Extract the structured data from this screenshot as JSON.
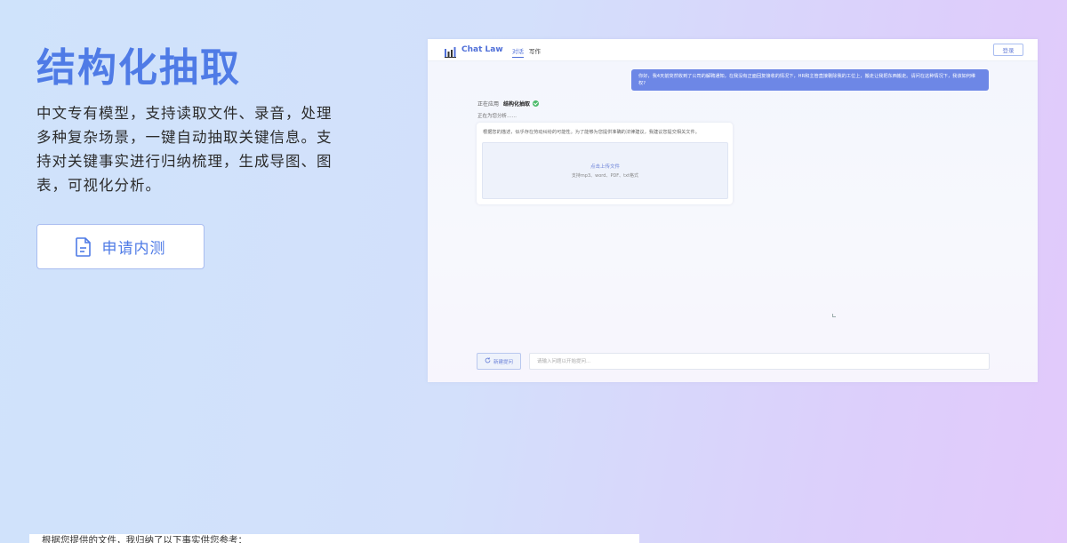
{
  "hero": {
    "title": "结构化抽取",
    "description": "中文专有模型，支持读取文件、录音，处理多种复杂场景，一键自动抽取关键信息。支持对关键事实进行归纳梳理，生成导图、图表，可视化分析。",
    "apply_button": "申请内测"
  },
  "preview": {
    "brand": "Chat Law",
    "tabs": [
      {
        "label": "对话",
        "active": true
      },
      {
        "label": "写作",
        "active": false
      }
    ],
    "login_button": "登录",
    "user_message": "你好，我4天前突然收到了公司的解聘通知，在我没有正面回复接收的情况下，HR和主管直接剔除我的工位上，搬走让我把东西搬走。请问在这种情况下，我该如何维权?",
    "status": {
      "prefix": "正在应用",
      "skill": "结构化抽取"
    },
    "analyzing": "正在为您分析……",
    "ai_reply": "根据您的描述，似乎存在劳动纠纷的可能性。为了能够为您提供准确的法律建议，我建议您提交相关文件。",
    "upload": {
      "title": "点击上传文件",
      "formats": "支持mp3、word、PDF、txt格式"
    },
    "new_chat_button": "新建提问",
    "input_placeholder": "请输入问题以开始提问..."
  },
  "bottom_panel": {
    "text": "根据您提供的文件，我归纳了以下事实供您参考："
  },
  "colors": {
    "accent": "#4f7be6",
    "bubble": "#6d87e6",
    "success": "#4cbb6b"
  }
}
